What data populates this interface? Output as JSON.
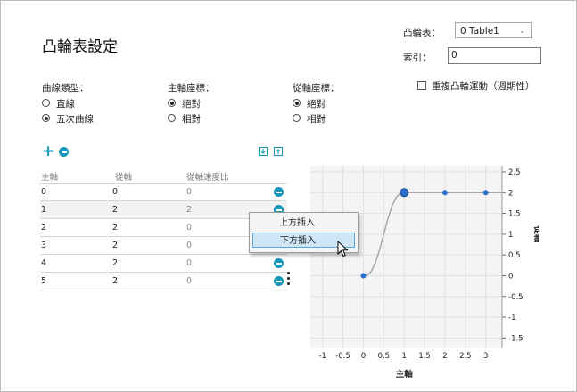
{
  "page": {
    "title": "凸輪表設定"
  },
  "cam_table": {
    "label": "凸輪表：",
    "selected": "0 Table1"
  },
  "index": {
    "label": "索引：",
    "value": "0"
  },
  "curve_type": {
    "label": "曲線類型：",
    "options": [
      "直線",
      "五次曲線"
    ],
    "selected": 1
  },
  "master_coord": {
    "label": "主軸座標：",
    "options": [
      "絕對",
      "相對"
    ],
    "selected": 0
  },
  "slave_coord": {
    "label": "從軸座標：",
    "options": [
      "絕對",
      "相對"
    ],
    "selected": 0
  },
  "repeat": {
    "label": "重複凸輪運動（週期性）",
    "checked": false
  },
  "toolbar": {
    "add_icon": "plus-icon",
    "remove_icon": "minus-icon",
    "import_icon": "download-icon",
    "export_icon": "upload-icon"
  },
  "table": {
    "columns": [
      "主軸",
      "從軸",
      "從軸速度比"
    ],
    "rows": [
      [
        "0",
        "0",
        "0"
      ],
      [
        "1",
        "2",
        "2"
      ],
      [
        "2",
        "2",
        "0"
      ],
      [
        "3",
        "2",
        "0"
      ],
      [
        "4",
        "2",
        "0"
      ],
      [
        "5",
        "2",
        "0"
      ]
    ]
  },
  "context_menu": {
    "items": [
      "上方插入",
      "下方插入"
    ],
    "highlighted": 1
  },
  "colors": {
    "accent": "#1595b8",
    "point": "#2a6fc9",
    "curve": "#a8a8a8"
  },
  "chart_data": {
    "type": "line",
    "x_ticks": [
      "-1",
      "-0.5",
      "0",
      "0.5",
      "1",
      "1.5",
      "2",
      "2.5",
      "3"
    ],
    "y_ticks": [
      "2.5",
      "2",
      "1.5",
      "1",
      "0.5",
      "0",
      "-0.5",
      "-1",
      "-1.5"
    ],
    "xlim": [
      -1.3,
      3.4
    ],
    "ylim": [
      -1.75,
      2.65
    ],
    "xlabel": "主軸",
    "ylabel": "從軸",
    "grid": true,
    "points": [
      [
        0,
        0
      ],
      [
        1,
        2
      ],
      [
        2,
        2
      ],
      [
        3,
        2
      ]
    ],
    "selected_point": 1,
    "curve": [
      [
        0,
        0
      ],
      [
        0.1,
        0.0172
      ],
      [
        0.2,
        0.1152
      ],
      [
        0.3,
        0.3266
      ],
      [
        0.4,
        0.6349
      ],
      [
        0.5,
        1.0
      ],
      [
        0.6,
        1.3651
      ],
      [
        0.7,
        1.6734
      ],
      [
        0.8,
        1.8848
      ],
      [
        0.9,
        1.9828
      ],
      [
        1,
        2
      ],
      [
        3.4,
        2
      ]
    ]
  }
}
